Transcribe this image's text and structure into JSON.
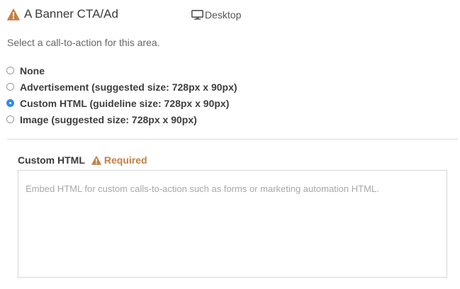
{
  "header": {
    "title": "A Banner CTA/Ad",
    "device_label": "Desktop",
    "warning_icon": "warning-triangle-icon",
    "device_icon": "monitor-icon"
  },
  "description": "Select a call-to-action for this area.",
  "options": [
    {
      "label": "None",
      "checked": false
    },
    {
      "label": "Advertisement (suggested size: 728px x 90px)",
      "checked": false
    },
    {
      "label": "Custom HTML (guideline size: 728px x 90px)",
      "checked": true
    },
    {
      "label": "Image (suggested size: 728px x 90px)",
      "checked": false
    }
  ],
  "custom_html": {
    "label": "Custom HTML",
    "required_label": "Required",
    "value": "",
    "placeholder": "Embed HTML for custom calls-to-action such as forms or marketing automation HTML."
  },
  "colors": {
    "warning": "#c48043",
    "radio_selected": "#2f8bf0"
  }
}
